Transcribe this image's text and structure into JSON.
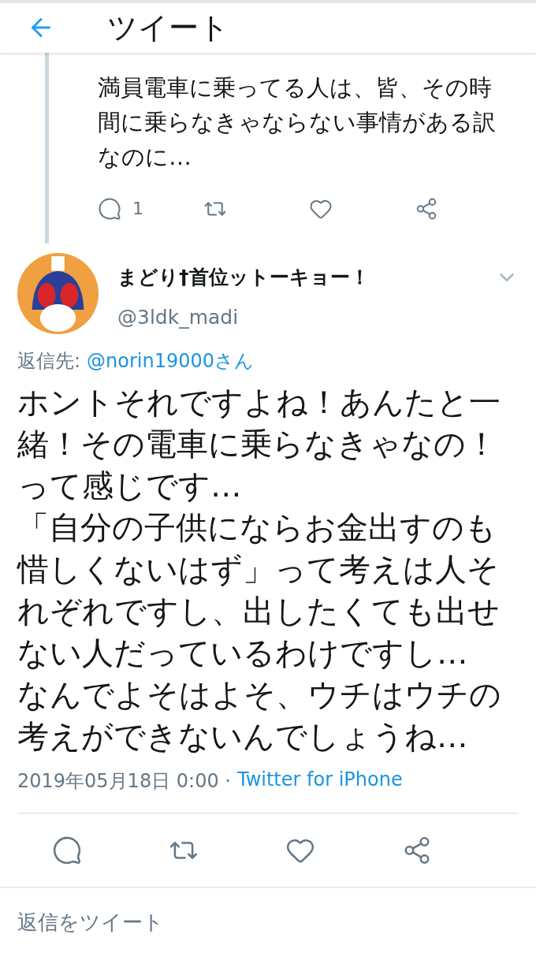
{
  "header": {
    "title": "ツイート"
  },
  "parent_tweet": {
    "text_lines": [
      "満員電車に乗ってる人は、皆、その時間に乗らなきゃならない事情がある訳なのに…"
    ],
    "actions": [
      {
        "kind": "reply",
        "count": "1"
      },
      {
        "kind": "retweet"
      },
      {
        "kind": "like"
      },
      {
        "kind": "share"
      }
    ]
  },
  "tweet": {
    "name": "まどり†首位ットーキョー！",
    "handle": "@3ldk_madi",
    "reply_to_label": "返信先:",
    "reply_to_user": "@norin19000さん",
    "paragraphs": [
      "ホントそれですよね！あんたと一緒！その電車に乗らなきゃなの！って感じです…",
      "「自分の子供にならお金出すのも惜しくないはず」って考えは人それぞれですし、出したくても出せない人だっているわけですし…",
      "なんでよそはよそ、ウチはウチの考えができないんでしょうね…"
    ],
    "timestamp": "2019年05月18日 0:00 ·",
    "source": "Twitter for iPhone",
    "actions": [
      {
        "kind": "reply"
      },
      {
        "kind": "retweet"
      },
      {
        "kind": "like"
      },
      {
        "kind": "share"
      }
    ]
  },
  "reply_box": {
    "placeholder": "返信をツイート"
  }
}
